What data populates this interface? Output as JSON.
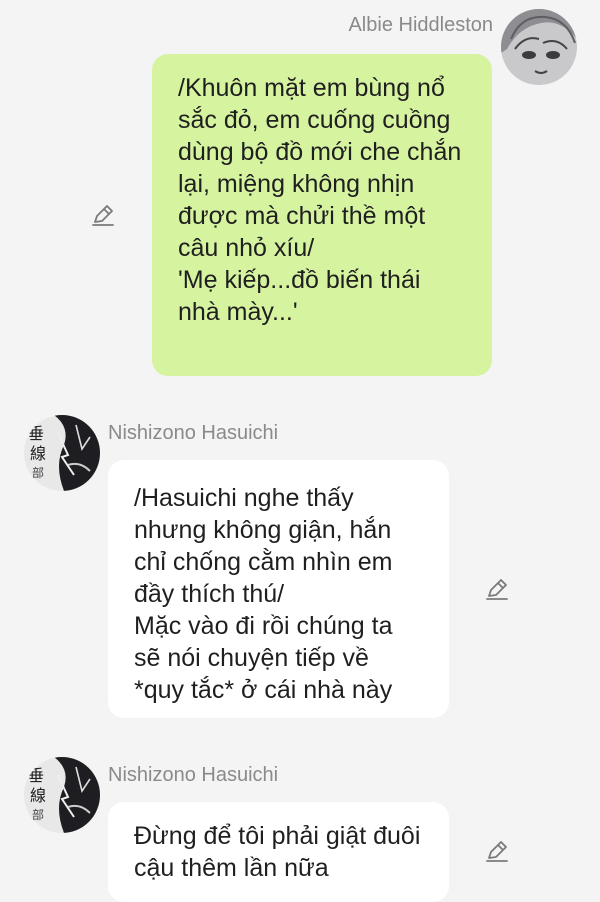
{
  "messages": [
    {
      "sender": "Albie Hiddleston",
      "direction": "outgoing",
      "text": "/Khuôn mặt em bùng nổ sắc đỏ, em cuống cuồng dùng bộ đồ mới che chắn lại, miệng không nhịn được mà chửi thề một câu nhỏ xíu/\n'Mẹ kiếp...đồ biến thái nhà mày...'"
    },
    {
      "sender": "Nishizono Hasuichi",
      "direction": "incoming",
      "text": "/Hasuichi nghe thấy nhưng không giận, hắn chỉ chống cằm nhìn em đầy thích thú/\nMặc vào đi rồi chúng ta sẽ nói chuyện tiếp về *quy tắc* ở cái nhà này"
    },
    {
      "sender": "Nishizono Hasuichi",
      "direction": "incoming",
      "text": "Đừng để tôi phải giật đuôi cậu thêm lần nữa"
    }
  ],
  "icons": {
    "edit": "pencil-edit-icon",
    "avatar_outgoing": "anime-avatar-albie",
    "avatar_incoming": "anime-avatar-nishizono"
  },
  "colors": {
    "background": "#f4f4f4",
    "outgoing_bubble": "#d6f3a0",
    "incoming_bubble": "#ffffff",
    "name_text": "#8a8a8a"
  }
}
